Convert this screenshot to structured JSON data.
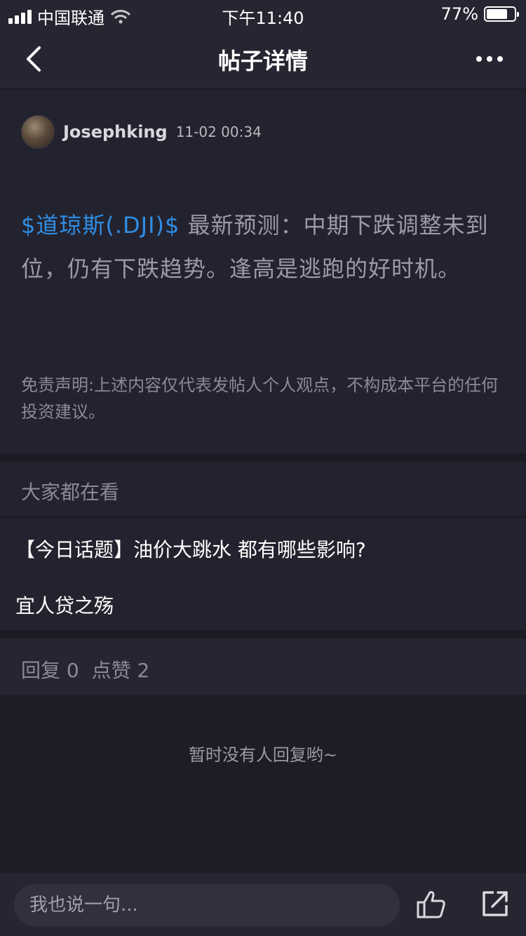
{
  "status_bar": {
    "carrier": "中国联通",
    "time": "下午11:40",
    "battery_text": "77%",
    "battery_level": 0.77
  },
  "nav": {
    "title": "帖子详情",
    "back_icon": "chevron-left-icon",
    "more_icon": "more-horizontal-icon"
  },
  "post": {
    "author": "Josephking",
    "time": "11-02 00:34",
    "stock_tag": "$道琼斯(.DJI)$",
    "body": " 最新预测：中期下跌调整未到位，仍有下跌趋势。逢高是逃跑的好时机。",
    "disclaimer": "免责声明:上述内容仅代表发帖人个人观点，不构成本平台的任何投资建议。"
  },
  "trending": {
    "title": "大家都在看",
    "items": [
      "【今日话题】油价大跳水 都有哪些影响?",
      "宜人贷之殇"
    ]
  },
  "stats": {
    "replies_label": "回复",
    "replies_count": "0",
    "likes_label": "点赞",
    "likes_count": "2"
  },
  "empty_replies": "暂时没有人回复哟~",
  "bottom_bar": {
    "input_placeholder": "我也说一句...",
    "like_icon": "thumbs-up-icon",
    "share_icon": "share-icon"
  },
  "colors": {
    "background": "#23232f",
    "link": "#2f8de4",
    "muted_text": "#8a8a96"
  }
}
